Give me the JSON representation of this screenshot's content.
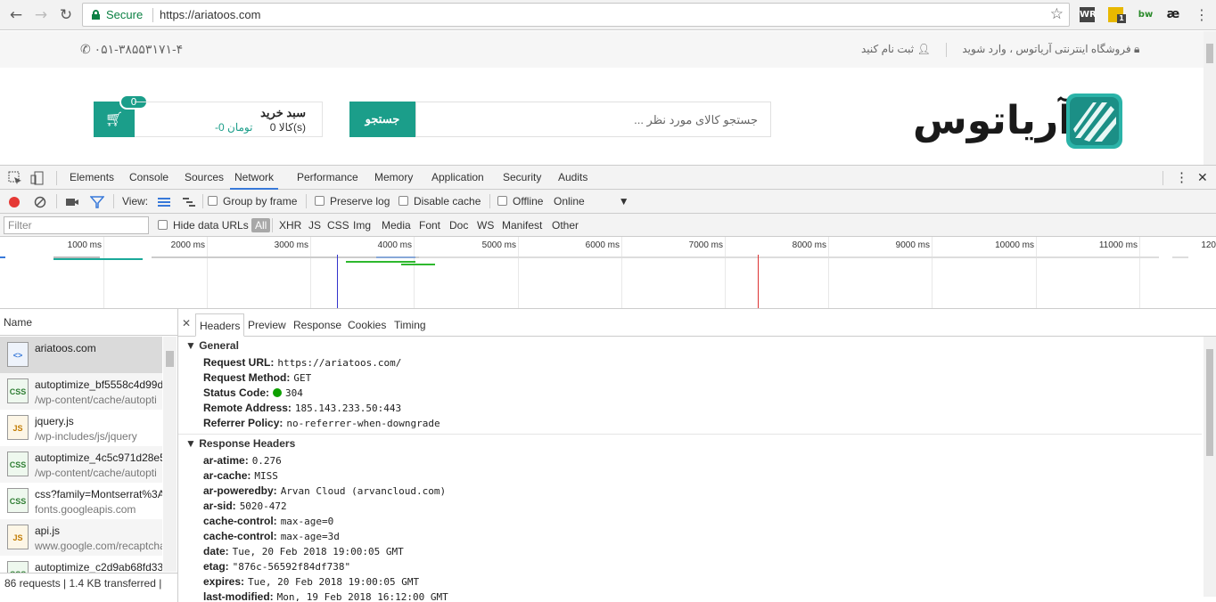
{
  "browser": {
    "secure_label": "Secure",
    "url": "https://ariatoos.com",
    "extensions": [
      "WR",
      "1",
      "bw",
      "æ"
    ]
  },
  "site": {
    "phone": "۰۵۱-۳۸۵۵۳۱۷۱-۴",
    "login_text": "فروشگاه اینترنتی آریاتوس ، وارد شوید",
    "register_text": "ثبت نام کنید",
    "cart_badge": "0",
    "cart_title": "سبد خرید",
    "cart_count": "0 کالا(s)",
    "cart_price": "-0 تومان",
    "search_button": "جستجو",
    "search_placeholder": "جستجو کالای مورد نظر ...",
    "logo_text": "آریاتوس",
    "accent_color": "#1b9e8a"
  },
  "devtools": {
    "tabs": [
      "Elements",
      "Console",
      "Sources",
      "Network",
      "Performance",
      "Memory",
      "Application",
      "Security",
      "Audits"
    ],
    "active_tab": "Network",
    "toolbar": {
      "view_label": "View:",
      "group_by_frame": "Group by frame",
      "preserve_log": "Preserve log",
      "disable_cache": "Disable cache",
      "offline": "Offline",
      "throttle": "Online"
    },
    "filter": {
      "placeholder": "Filter",
      "hide_data_urls": "Hide data URLs",
      "types": [
        "All",
        "XHR",
        "JS",
        "CSS",
        "Img",
        "Media",
        "Font",
        "Doc",
        "WS",
        "Manifest",
        "Other"
      ]
    },
    "timeline_labels": [
      "1000 ms",
      "2000 ms",
      "3000 ms",
      "4000 ms",
      "5000 ms",
      "6000 ms",
      "7000 ms",
      "8000 ms",
      "9000 ms",
      "10000 ms",
      "11000 ms",
      "120"
    ],
    "name_header": "Name",
    "requests": [
      {
        "name": "ariatoos.com",
        "path": "",
        "type": "<>"
      },
      {
        "name": "autoptimize_bf5558c4d99d",
        "path": "/wp-content/cache/autopti",
        "type": "CSS"
      },
      {
        "name": "jquery.js",
        "path": "/wp-includes/js/jquery",
        "type": "JS"
      },
      {
        "name": "autoptimize_4c5c971d28e5",
        "path": "/wp-content/cache/autopti",
        "type": "CSS"
      },
      {
        "name": "css?family=Montserrat%3A",
        "path": "fonts.googleapis.com",
        "type": "CSS"
      },
      {
        "name": "api.js",
        "path": "www.google.com/recaptcha",
        "type": "JS"
      },
      {
        "name": "autoptimize_c2d9ab68fd33",
        "path": "",
        "type": "CSS"
      }
    ],
    "status_summary": "86 requests | 1.4 KB transferred |",
    "detail_tabs": [
      "Headers",
      "Preview",
      "Response",
      "Cookies",
      "Timing"
    ],
    "general_title": "General",
    "general": [
      {
        "k": "Request URL:",
        "v": "https://ariatoos.com/"
      },
      {
        "k": "Request Method:",
        "v": "GET"
      },
      {
        "k": "Status Code:",
        "v": "304"
      },
      {
        "k": "Remote Address:",
        "v": "185.143.233.50:443"
      },
      {
        "k": "Referrer Policy:",
        "v": "no-referrer-when-downgrade"
      }
    ],
    "response_title": "Response Headers",
    "response_headers": [
      {
        "k": "ar-atime:",
        "v": "0.276"
      },
      {
        "k": "ar-cache:",
        "v": "MISS"
      },
      {
        "k": "ar-poweredby:",
        "v": "Arvan Cloud (arvancloud.com)"
      },
      {
        "k": "ar-sid:",
        "v": "5020-472"
      },
      {
        "k": "cache-control:",
        "v": "max-age=0"
      },
      {
        "k": "cache-control:",
        "v": "max-age=3d"
      },
      {
        "k": "date:",
        "v": "Tue, 20 Feb 2018 19:00:05 GMT"
      },
      {
        "k": "etag:",
        "v": "\"876c-56592f84df738\""
      },
      {
        "k": "expires:",
        "v": "Tue, 20 Feb 2018 19:00:05 GMT"
      },
      {
        "k": "last-modified:",
        "v": "Mon, 19 Feb 2018 16:12:00 GMT"
      }
    ]
  }
}
